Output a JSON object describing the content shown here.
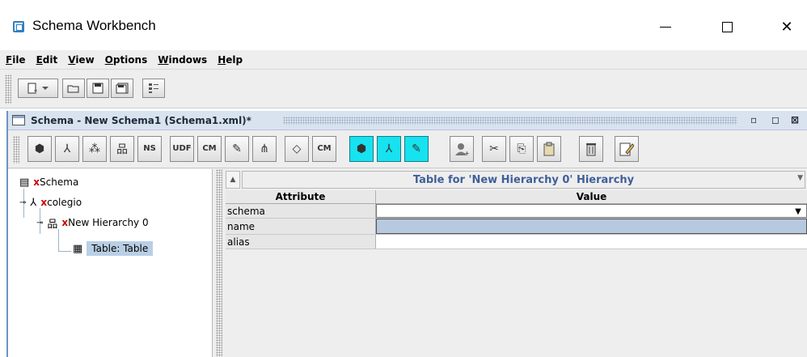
{
  "window": {
    "title": "Schema Workbench",
    "min_glyph": "—",
    "max_glyph": "☐",
    "close_glyph": "✕"
  },
  "menu": {
    "items": [
      {
        "mnemonic": "F",
        "rest": "ile"
      },
      {
        "mnemonic": "E",
        "rest": "dit"
      },
      {
        "mnemonic": "V",
        "rest": "iew"
      },
      {
        "mnemonic": "O",
        "rest": "ptions"
      },
      {
        "mnemonic": "W",
        "rest": "indows"
      },
      {
        "mnemonic": "H",
        "rest": "elp"
      }
    ]
  },
  "main_toolbar": {
    "buttons": [
      "new-schema-icon",
      "dropdown-icon",
      "open-icon",
      "save-icon",
      "save-as-icon",
      "jdbc-explorer-icon"
    ]
  },
  "schema_frame": {
    "title": "Schema - New Schema1 (Schema1.xml)*",
    "controls": [
      "restore-icon",
      "maximize-icon",
      "close-icon"
    ]
  },
  "schema_toolbar": {
    "buttons": [
      {
        "name": "add-cube-button",
        "glyph": "⬢"
      },
      {
        "name": "add-dimension-button",
        "glyph": "⅄"
      },
      {
        "name": "add-dimension-usage-button",
        "glyph": "⁂"
      },
      {
        "name": "add-hierarchy-button",
        "glyph": "品"
      },
      {
        "name": "add-named-set-button",
        "glyph": "NS"
      },
      {
        "name": "add-user-defined-function-button",
        "glyph": "UDF"
      },
      {
        "name": "add-calculated-member-button",
        "glyph": "CM"
      },
      {
        "name": "add-measure-button",
        "glyph": "✎"
      },
      {
        "name": "add-level-button",
        "glyph": "⋔"
      },
      {
        "name": "add-property-button",
        "glyph": "◇"
      },
      {
        "name": "add-measure-calculated-member-button",
        "glyph": "CM"
      },
      {
        "name": "add-virtual-cube-button",
        "glyph": "⬢"
      },
      {
        "name": "add-virtual-dimension-button",
        "glyph": "⅄"
      },
      {
        "name": "add-virtual-measure-button",
        "glyph": "✎"
      },
      {
        "name": "add-role-button",
        "glyph": "👤"
      },
      {
        "name": "cut-button",
        "glyph": "✂"
      },
      {
        "name": "copy-button",
        "glyph": "⎘"
      },
      {
        "name": "paste-button",
        "glyph": "📋"
      },
      {
        "name": "delete-button",
        "glyph": "🗑"
      },
      {
        "name": "edit-button",
        "glyph": "✎"
      }
    ]
  },
  "tree": {
    "nodes": [
      {
        "name": "tree-node-schema",
        "icon": "▤",
        "x": "x",
        "label": "Schema"
      },
      {
        "name": "tree-node-cube",
        "icon": "⅄",
        "x": "x",
        "label": "colegio"
      },
      {
        "name": "tree-node-hierarchy",
        "icon": "品",
        "x": "x",
        "label": "New Hierarchy 0"
      },
      {
        "name": "tree-node-table",
        "icon": "▦",
        "x": "",
        "label": "Table: Table"
      }
    ]
  },
  "details": {
    "title": "Table for 'New Hierarchy 0' Hierarchy",
    "headers": {
      "attribute": "Attribute",
      "value": "Value"
    },
    "rows": [
      {
        "attribute": "schema",
        "value": ""
      },
      {
        "attribute": "name",
        "value": ""
      },
      {
        "attribute": "alias",
        "value": ""
      }
    ]
  }
}
